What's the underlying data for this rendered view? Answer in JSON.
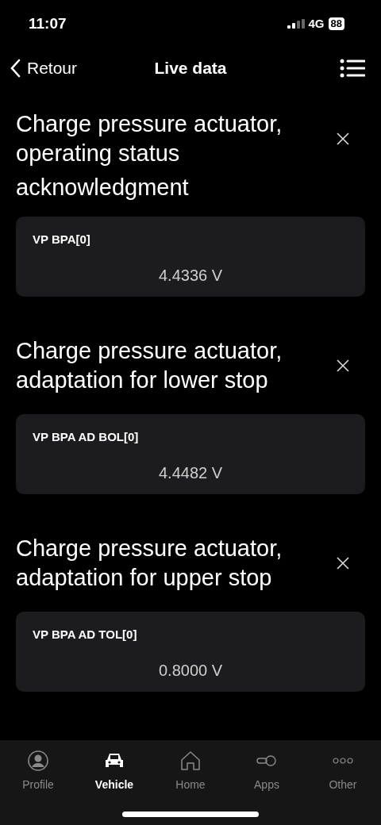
{
  "status_bar": {
    "time": "11:07",
    "network": "4G",
    "battery": "88"
  },
  "header": {
    "back": "Retour",
    "title": "Live data"
  },
  "sections": [
    {
      "title": "Charge pressure actuator, operating status",
      "continuation": "acknowledgment",
      "label": "VP BPA[0]",
      "value": "4.4336 V"
    },
    {
      "title": "Charge pressure actuator, adaptation for lower stop",
      "label": "VP BPA AD BOL[0]",
      "value": "4.4482 V"
    },
    {
      "title": "Charge pressure actuator, adaptation for upper stop",
      "label": "VP BPA AD TOL[0]",
      "value": "0.8000 V"
    }
  ],
  "tab_bar": [
    {
      "label": "Profile",
      "kind": "profile",
      "selected": false
    },
    {
      "label": "Vehicle",
      "kind": "vehicle",
      "selected": true
    },
    {
      "label": "Home",
      "kind": "home",
      "selected": false
    },
    {
      "label": "Apps",
      "kind": "apps",
      "selected": false
    },
    {
      "label": "Other",
      "kind": "other",
      "selected": false
    }
  ]
}
